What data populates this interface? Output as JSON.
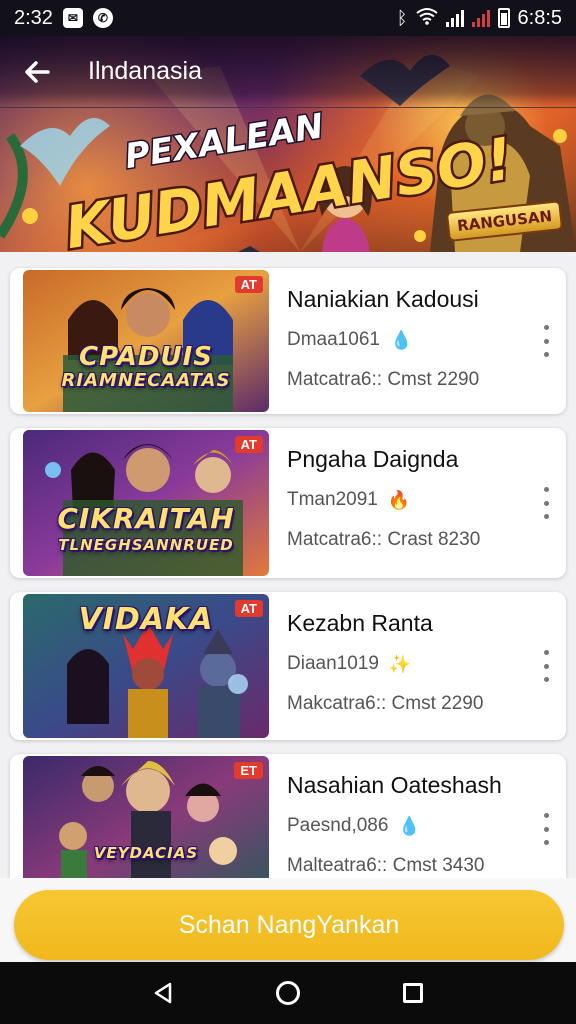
{
  "status_bar": {
    "time": "2:32",
    "clock_right": "6:8:5",
    "icons": [
      "mail-icon",
      "whatsapp-icon",
      "bluetooth-icon",
      "wifi-icon",
      "signal-icon",
      "signal-icon",
      "battery-icon"
    ]
  },
  "header": {
    "back_icon": "arrow-left-icon",
    "title": "Ilndanasia"
  },
  "banner": {
    "headline_top": "PEXALEAN",
    "headline_main": "KUDMAANSO!",
    "badge": "RANGUSAN"
  },
  "games": [
    {
      "title": "Naniakian Kadousi",
      "subtitle": "Dmaa1061",
      "meta": "Matcatra6:: Cmst 2290",
      "tag": "AT",
      "thumb_line1": "CPADUIS",
      "thumb_line2": "RIAMNECAATAS",
      "drop_icon": "water-drop-icon"
    },
    {
      "title": "Pngaha Daignda",
      "subtitle": "Tman2091",
      "meta": "Matcatra6:: Crast 8230",
      "tag": "AT",
      "thumb_line1": "CIKRAITAH",
      "thumb_line2": "TLNEGHSANNRUED",
      "drop_icon": "fire-icon"
    },
    {
      "title": "Kezabn Ranta",
      "subtitle": "Diaan1019",
      "meta": "Makcatra6:: Cmst 2290",
      "tag": "AT",
      "thumb_line1": "VIDAKA",
      "thumb_line2": "",
      "drop_icon": "magic-icon"
    },
    {
      "title": "Nasahian Oateshash",
      "subtitle": "Paesnd,086",
      "meta": "Malteatra6:: Cmst 3430",
      "tag": "ET",
      "thumb_line1": "VEYDACIAS",
      "thumb_line2": "",
      "drop_icon": "water-drop-icon"
    }
  ],
  "action_button": {
    "label": "Schan NangYankan"
  },
  "nav": {
    "back": "nav-back-icon",
    "home": "nav-home-icon",
    "recent": "nav-recent-icon"
  },
  "colors": {
    "accent": "#f2bd24",
    "tag_red": "#e23b2e",
    "status_bg": "#121018",
    "nav_bg": "#0b0b0b"
  }
}
